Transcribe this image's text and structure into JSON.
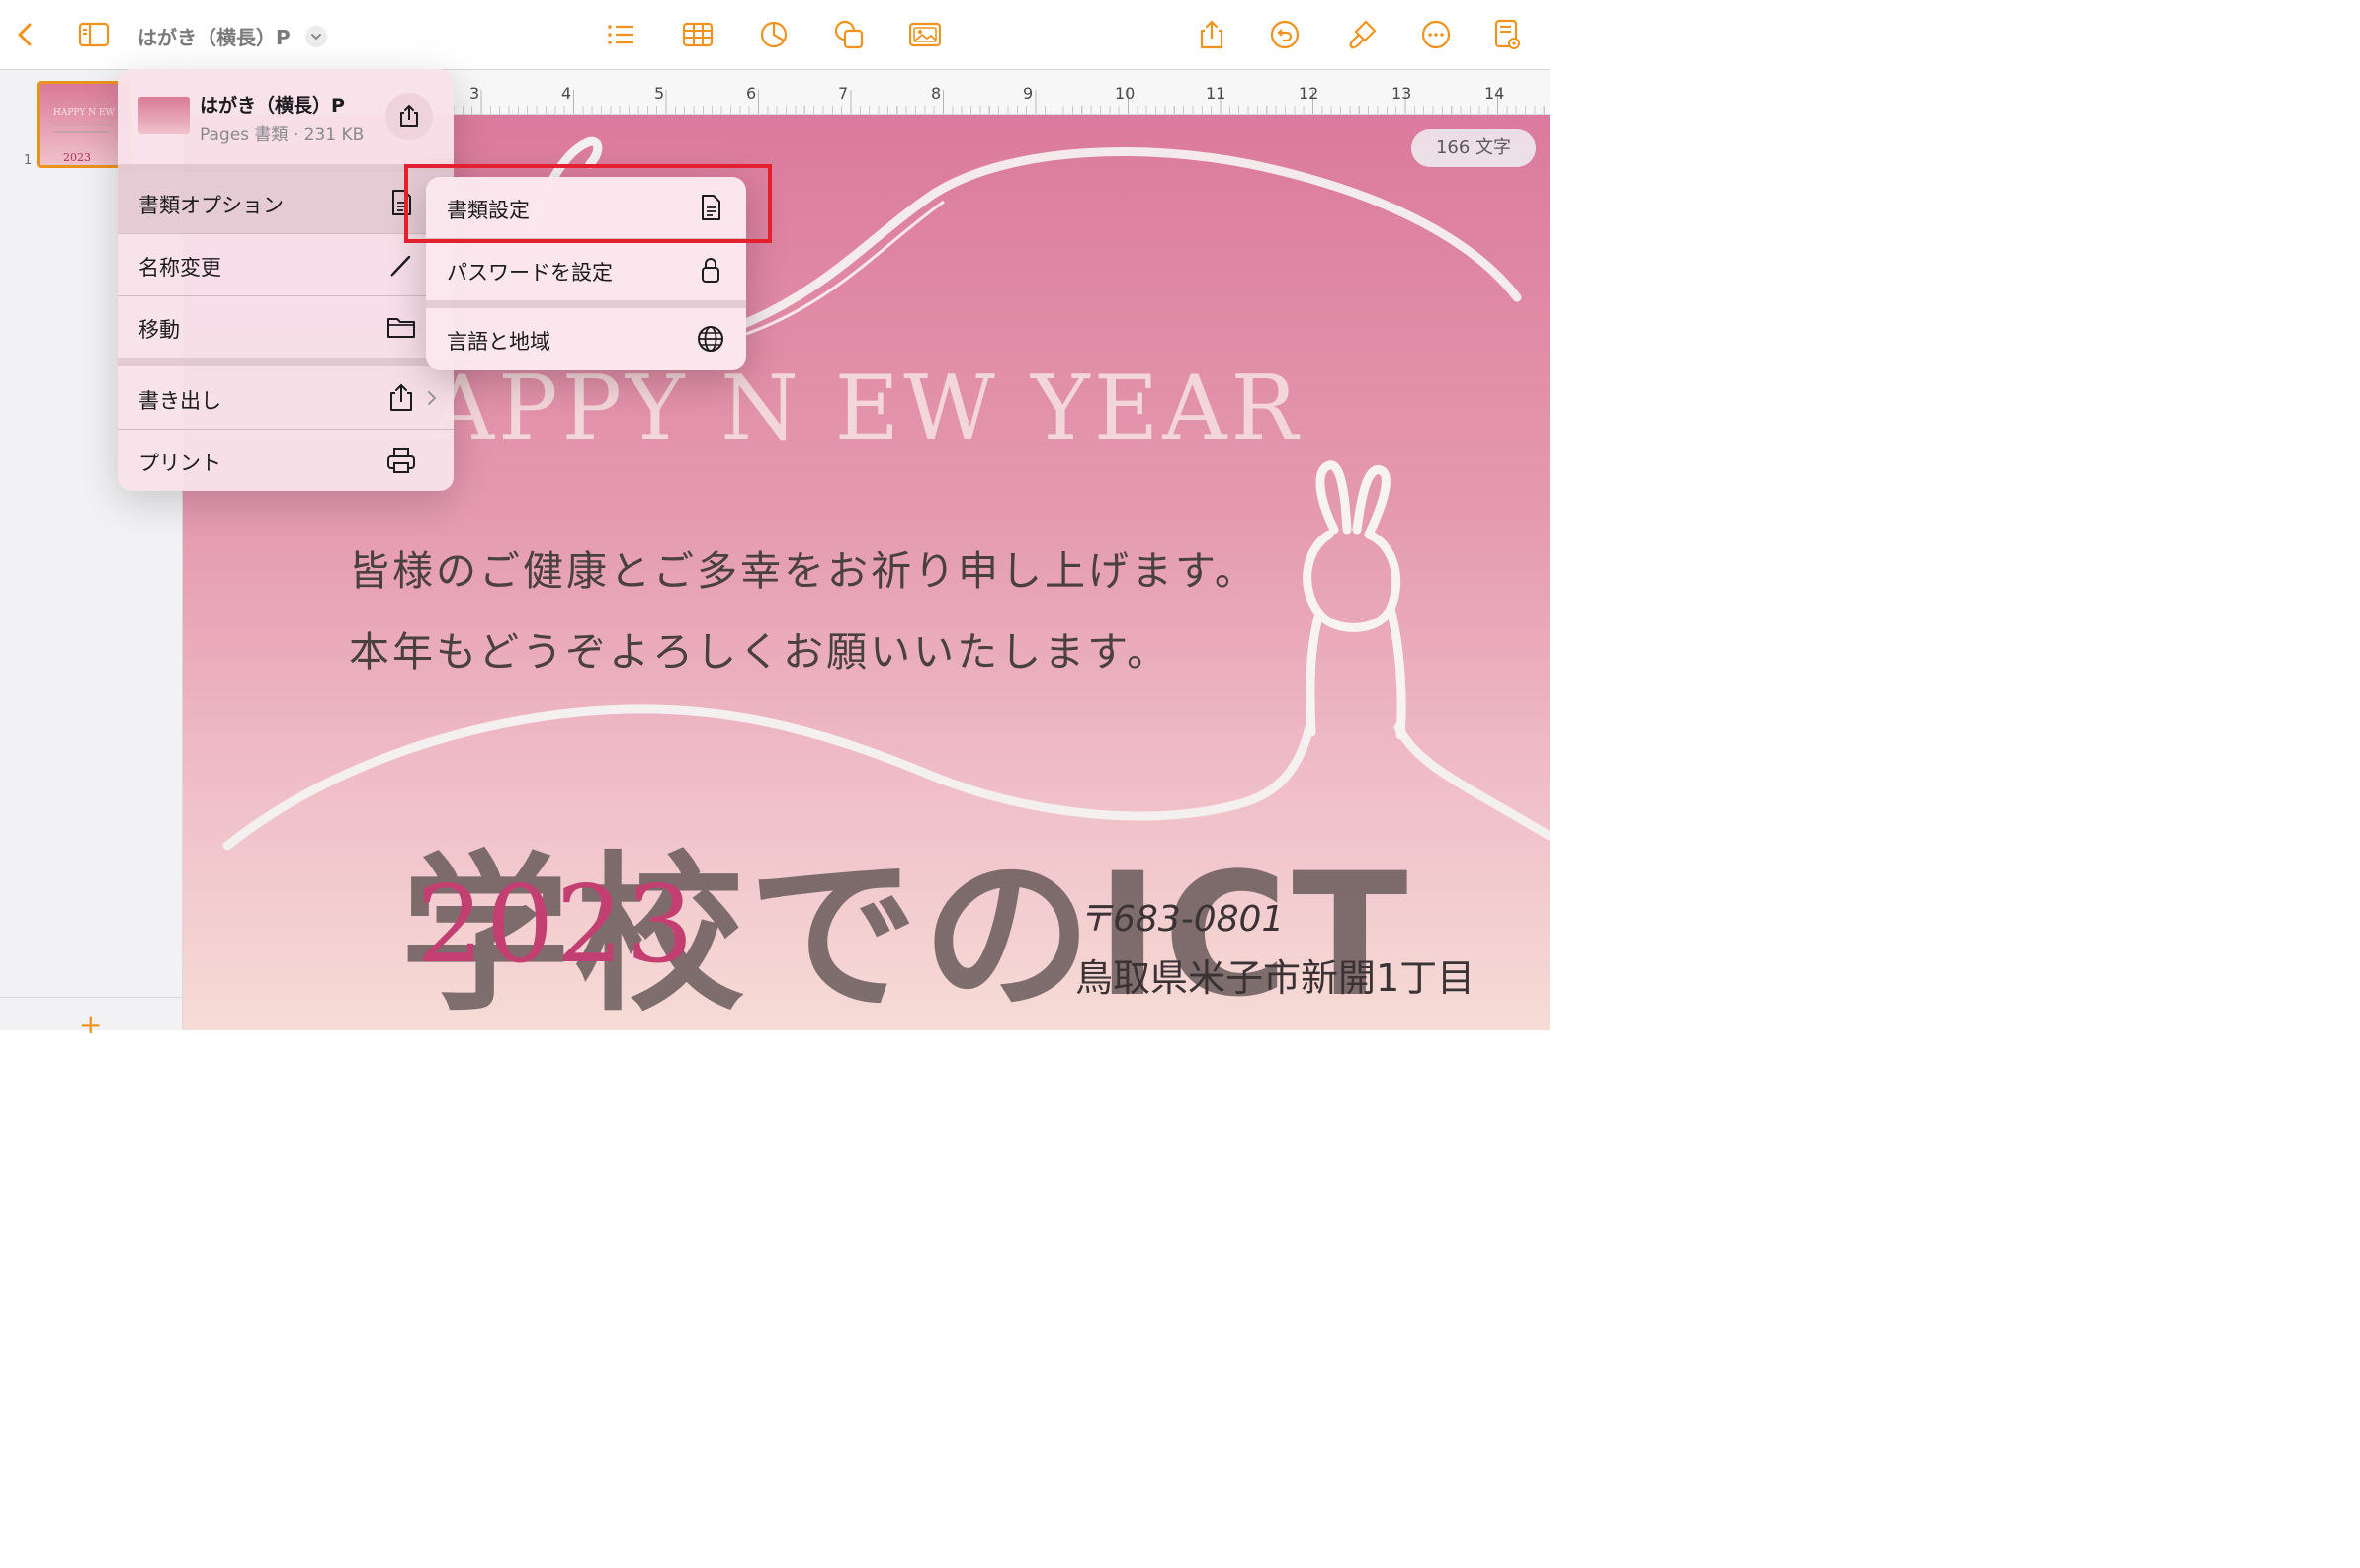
{
  "toolbar": {
    "title": "はがき（横長）P",
    "icons": [
      "back-chevron-icon",
      "sidebar-toggle-icon",
      "title-dropdown-icon",
      "list-icon",
      "table-icon",
      "chart-icon",
      "shapes-icon",
      "media-icon",
      "share-icon",
      "undo-icon",
      "format-brush-icon",
      "more-icon",
      "document-view-icon"
    ],
    "accent_color": "#f0931e"
  },
  "sidebar": {
    "thumbnail": {
      "title": "HAPPY N EW",
      "year": "2023",
      "page_number": "1"
    },
    "add_page_label": "+"
  },
  "ruler": {
    "numbers": [
      "3",
      "4",
      "5",
      "6",
      "7",
      "8",
      "9",
      "10",
      "11",
      "12",
      "13",
      "14"
    ]
  },
  "document": {
    "char_count": "166 文字",
    "headline": "APPY N EW YEAR",
    "greeting_line1": "皆様のご健康とご多幸をお祈り申し上げます。",
    "greeting_line2": "本年もどうぞよろしくお願いいたします。",
    "watermark": "学校でのICT",
    "year": "2023",
    "postal_code": "〒683-0801",
    "address": "鳥取県米子市新開1丁目",
    "background_colors": [
      "#db7a9c",
      "#f6dcd6"
    ],
    "year_color": "#c33f72"
  },
  "popover": {
    "file_name": "はがき（横長）P",
    "file_meta": "Pages 書類 · 231 KB",
    "items": [
      {
        "label": "書類オプション",
        "icon": "document-icon",
        "active": true
      },
      {
        "label": "名称変更",
        "icon": "pencil-icon"
      },
      {
        "label": "移動",
        "icon": "folder-icon"
      },
      {
        "label": "書き出し",
        "icon": "export-icon",
        "has_submenu": true
      },
      {
        "label": "プリント",
        "icon": "printer-icon"
      }
    ]
  },
  "submenu": {
    "items": [
      {
        "label": "書類設定",
        "icon": "document-icon",
        "highlighted": true
      },
      {
        "label": "パスワードを設定",
        "icon": "lock-icon"
      },
      {
        "label": "言語と地域",
        "icon": "globe-icon"
      }
    ],
    "highlight_color": "#e5202e"
  }
}
